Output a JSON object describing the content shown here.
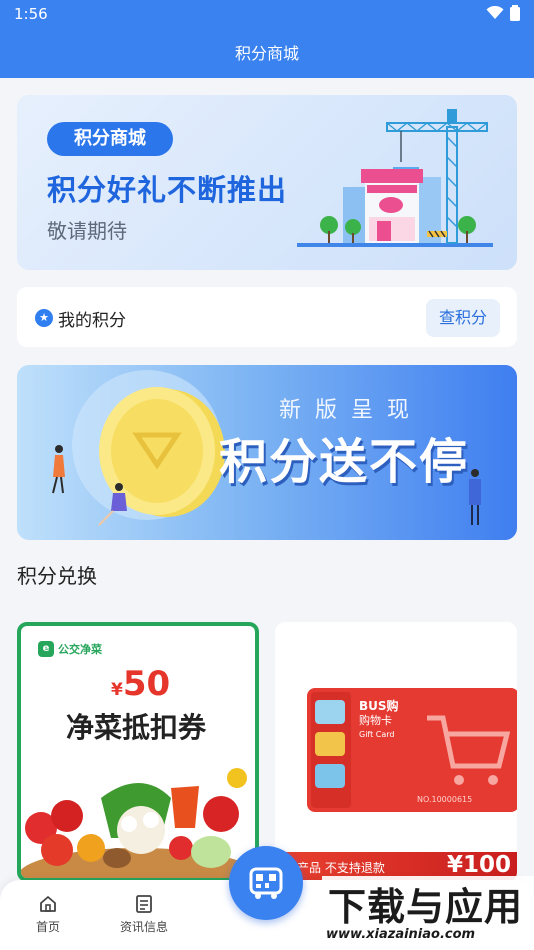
{
  "status_bar": {
    "time": "1:56",
    "icons": [
      "wifi-icon",
      "battery-icon"
    ]
  },
  "header": {
    "title": "积分商城"
  },
  "banner_top": {
    "pill": "积分商城",
    "headline": "积分好礼不断推出",
    "subtitle": "敬请期待"
  },
  "my_points": {
    "label": "我的积分",
    "button": "查积分"
  },
  "banner_promo": {
    "tagline": "新版呈现",
    "headline": "积分送不停"
  },
  "exchange": {
    "title": "积分兑换",
    "products": [
      {
        "brand": "公交净菜",
        "currency": "¥",
        "price": "50",
        "name": "净菜抵扣券"
      },
      {
        "card_title": "BUS购",
        "card_title2": "购物卡",
        "card_sub": "Gift Card",
        "card_no": "NO.10000615",
        "note": "密产品 不支持退款",
        "price": "¥100"
      }
    ]
  },
  "tab_bar": {
    "items": [
      {
        "label": "首页",
        "icon": "home-icon"
      },
      {
        "label": "资讯信息",
        "icon": "news-icon"
      }
    ],
    "center_icon": "bus-qr-icon"
  },
  "watermark": {
    "title": "下载与应用",
    "url": "www.xiazainiao.com"
  },
  "colors": {
    "primary": "#3a82f0",
    "green": "#26a65b",
    "red": "#e6352a"
  }
}
